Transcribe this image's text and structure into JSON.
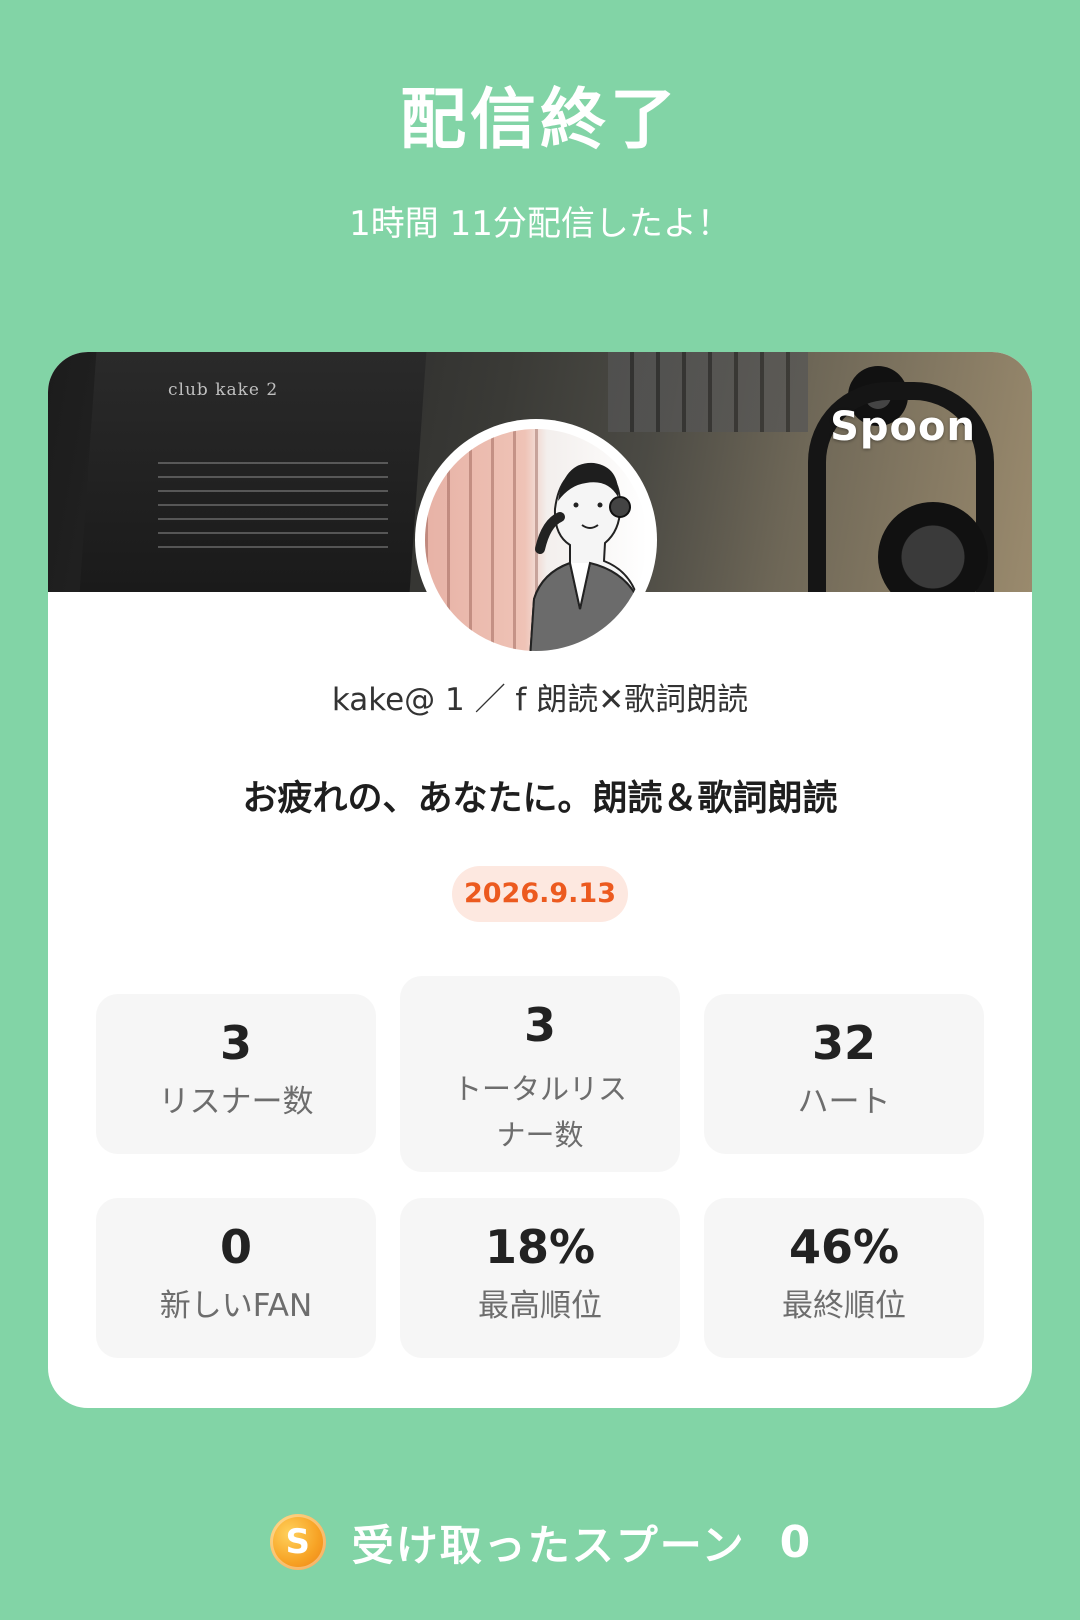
{
  "header": {
    "title": "配信終了",
    "subtitle": "1時間 11分配信したよ！"
  },
  "card": {
    "brand": "Spoon",
    "cover_text": "club kake 2",
    "username": "kake@ 1 ／ f 朗読✕歌詞朗読",
    "show_title": "お疲れの、あなたに。朗読＆歌詞朗読",
    "date": "2026.9.13",
    "stats": [
      {
        "value": "3",
        "label": "リスナー数"
      },
      {
        "value": "3",
        "label": "トータルリスナー数"
      },
      {
        "value": "32",
        "label": "ハート"
      },
      {
        "value": "0",
        "label": "新しいFAN"
      },
      {
        "value": "18%",
        "label": "最高順位"
      },
      {
        "value": "46%",
        "label": "最終順位"
      }
    ]
  },
  "footer": {
    "coin_icon": "spoon-coin-icon",
    "coin_letter": "S",
    "label": "受け取ったスプーン",
    "count": "0"
  },
  "colors": {
    "background": "#82d4a6",
    "card": "#ffffff",
    "stat_box": "#f6f6f6",
    "date_badge_bg": "#fde8e0",
    "date_badge_text": "#ec5a1f"
  }
}
